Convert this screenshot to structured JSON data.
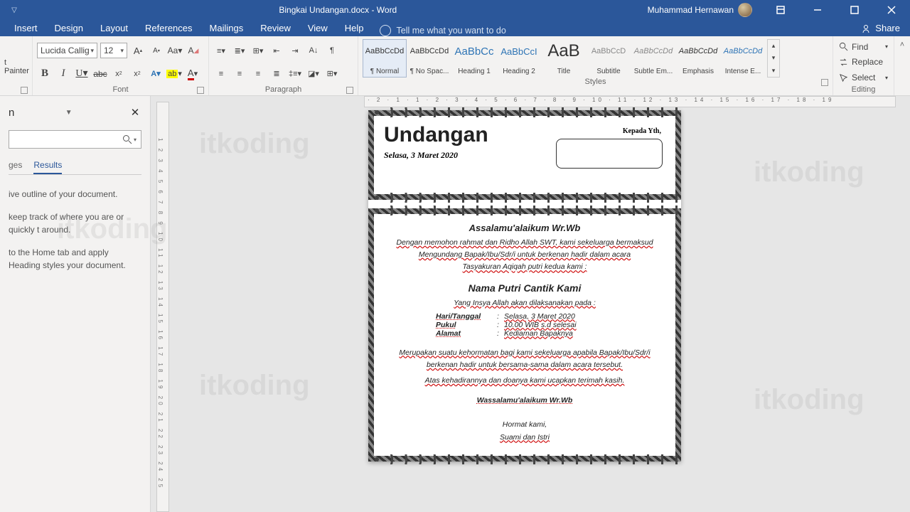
{
  "titlebar": {
    "doc_title": "Bingkai Undangan.docx  -  Word",
    "user_name": "Muhammad Hernawan"
  },
  "tabs": {
    "items": [
      "Insert",
      "Design",
      "Layout",
      "References",
      "Mailings",
      "Review",
      "View",
      "Help"
    ],
    "tell_me": "Tell me what you want to do",
    "share": "Share"
  },
  "ribbon": {
    "clipboard": {
      "painter": "t Painter",
      "label": ""
    },
    "font": {
      "name": "Lucida Callig",
      "size": "12",
      "label": "Font"
    },
    "paragraph": {
      "label": "Paragraph"
    },
    "styles": {
      "label": "Styles",
      "tiles": [
        {
          "preview": "AaBbCcDd",
          "name": "¶ Normal",
          "selected": true,
          "style": "font-size:11px;"
        },
        {
          "preview": "AaBbCcDd",
          "name": "¶ No Spac...",
          "style": "font-size:11px;"
        },
        {
          "preview": "AaBbCc",
          "name": "Heading 1",
          "style": "font-size:15px;color:#2e74b5;"
        },
        {
          "preview": "AaBbCcI",
          "name": "Heading 2",
          "style": "font-size:13px;color:#2e74b5;"
        },
        {
          "preview": "AaB",
          "name": "Title",
          "style": "font-size:24px;"
        },
        {
          "preview": "AaBbCcD",
          "name": "Subtitle",
          "style": "font-size:11px;color:#888;"
        },
        {
          "preview": "AaBbCcDd",
          "name": "Subtle Em...",
          "style": "font-size:11px;font-style:italic;color:#888;"
        },
        {
          "preview": "AaBbCcDd",
          "name": "Emphasis",
          "style": "font-size:11px;font-style:italic;"
        },
        {
          "preview": "AaBbCcDd",
          "name": "Intense E...",
          "style": "font-size:11px;font-style:italic;color:#2e74b5;"
        }
      ]
    },
    "editing": {
      "find": "Find",
      "replace": "Replace",
      "select": "Select",
      "label": "Editing"
    }
  },
  "nav": {
    "heading_truncated": "n",
    "tabs": [
      "ges",
      "Results"
    ],
    "body": [
      "ive outline of your document.",
      "keep track of where you are or quickly t around.",
      "to the Home tab and apply Heading styles your document."
    ]
  },
  "rulers": {
    "h": "· 2 · 1 · 1 · 2 · 3 · 4 · 5 · 6 · 7 · 8 · 9 · 10 · 11 · 12 · 13 · 14 · 15 · 16 · 17 · 18 · 19",
    "v": "1 2 3 4 5 6 7 8 9 10 11 12 13 14 15 16 17 18 19 20 21 22 23 24 25"
  },
  "doc": {
    "title": "Undangan",
    "date": "Selasa, 3 Maret 2020",
    "kepada": "Kepada Yth,",
    "salam": "Assalamu'alaikum Wr.Wb",
    "intro1": "Dengan memohon rahmat dan Ridho Allah SWT, kami sekeluarga bermaksud",
    "intro2": "Mengundang Bapak/Ibu/Sdr/i untuk berkenan hadir dalam acara",
    "intro3": "Tasyakuran Aqiqah putri kedua kami :",
    "child": "Nama Putri Cantik Kami",
    "insya": "Yang Insya Allah akan dilaksanakan  pada :",
    "rows": [
      {
        "k": "Hari/Tanggal",
        "v": "Selasa, 3 Maret 2020"
      },
      {
        "k": "Pukul",
        "v": "10.00 WIB s.d selesai"
      },
      {
        "k": "Alamat",
        "v": "Kediaman Bapaknya"
      }
    ],
    "honor1": "Merupakan suatu kehormatan bagi kami sekeluarga apabila Bapak/Ibu/Sdr/i",
    "honor2": "berkenan hadir untuk bersama-sama dalam acara tersebut.",
    "thanks": "Atas kehadirannya dan doanya kami ucapkan terimah kasih.",
    "wass": "Wassalamu'alaikum Wr.Wb",
    "hormat": "Hormat kami,",
    "sig": "Suami dan Istri"
  },
  "watermark": "itkoding",
  "colors": {
    "brand": "#2b579a"
  }
}
